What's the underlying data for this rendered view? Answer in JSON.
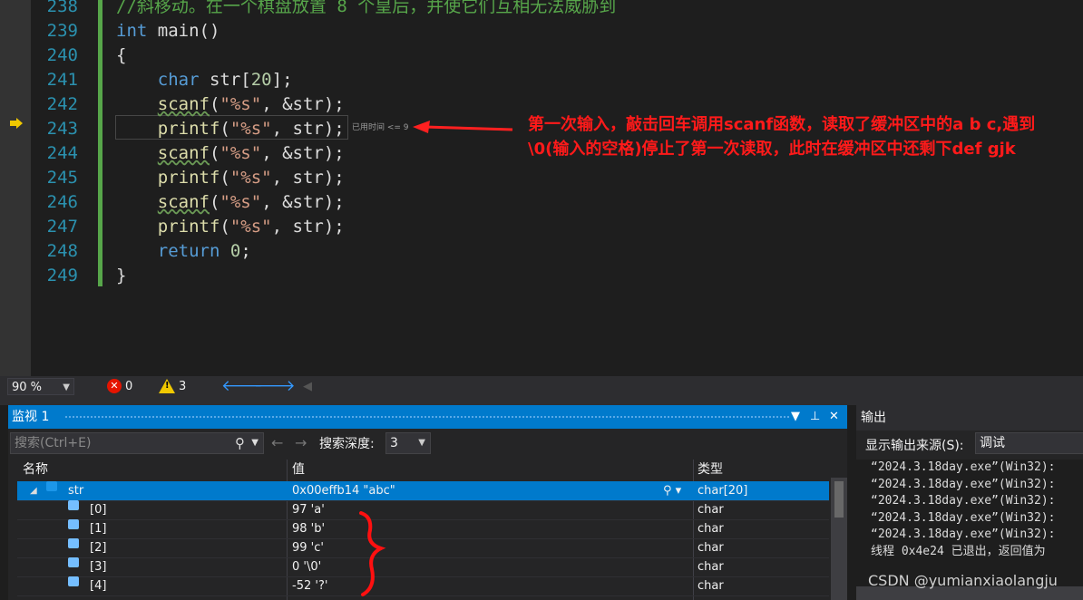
{
  "editor": {
    "lines": [
      {
        "num": "238",
        "parts": [
          {
            "t": "//斜移动。在一个棋盘放置 8 个皇后，并使它们互相无法威胁到",
            "c": "cm"
          }
        ]
      },
      {
        "num": "239",
        "parts": [
          {
            "t": "int",
            "c": "kw"
          },
          {
            "t": " main()",
            "c": "id"
          }
        ]
      },
      {
        "num": "240",
        "parts": [
          {
            "t": "{",
            "c": "id"
          }
        ]
      },
      {
        "num": "241",
        "parts": [
          {
            "t": "    ",
            "c": "id"
          },
          {
            "t": "char",
            "c": "kw"
          },
          {
            "t": " str[",
            "c": "id"
          },
          {
            "t": "20",
            "c": "num"
          },
          {
            "t": "];",
            "c": "id"
          }
        ]
      },
      {
        "num": "242",
        "parts": [
          {
            "t": "    ",
            "c": "id"
          },
          {
            "t": "scanf",
            "c": "fn wavy"
          },
          {
            "t": "(",
            "c": "id"
          },
          {
            "t": "\"%s\"",
            "c": "str"
          },
          {
            "t": ", &str);",
            "c": "id"
          }
        ]
      },
      {
        "num": "243",
        "parts": [
          {
            "t": "    ",
            "c": "id"
          },
          {
            "t": "printf",
            "c": "fn"
          },
          {
            "t": "(",
            "c": "id"
          },
          {
            "t": "\"%s\"",
            "c": "str"
          },
          {
            "t": ", str);",
            "c": "id"
          }
        ]
      },
      {
        "num": "244",
        "parts": [
          {
            "t": "    ",
            "c": "id"
          },
          {
            "t": "scanf",
            "c": "fn wavy"
          },
          {
            "t": "(",
            "c": "id"
          },
          {
            "t": "\"%s\"",
            "c": "str"
          },
          {
            "t": ", &str);",
            "c": "id"
          }
        ]
      },
      {
        "num": "245",
        "parts": [
          {
            "t": "    ",
            "c": "id"
          },
          {
            "t": "printf",
            "c": "fn"
          },
          {
            "t": "(",
            "c": "id"
          },
          {
            "t": "\"%s\"",
            "c": "str"
          },
          {
            "t": ", str);",
            "c": "id"
          }
        ]
      },
      {
        "num": "246",
        "parts": [
          {
            "t": "    ",
            "c": "id"
          },
          {
            "t": "scanf",
            "c": "fn wavy"
          },
          {
            "t": "(",
            "c": "id"
          },
          {
            "t": "\"%s\"",
            "c": "str"
          },
          {
            "t": ", &str);",
            "c": "id"
          }
        ]
      },
      {
        "num": "247",
        "parts": [
          {
            "t": "    ",
            "c": "id"
          },
          {
            "t": "printf",
            "c": "fn"
          },
          {
            "t": "(",
            "c": "id"
          },
          {
            "t": "\"%s\"",
            "c": "str"
          },
          {
            "t": ", str);",
            "c": "id"
          }
        ]
      },
      {
        "num": "248",
        "parts": [
          {
            "t": "    ",
            "c": "id"
          },
          {
            "t": "return",
            "c": "kw"
          },
          {
            "t": " ",
            "c": "id"
          },
          {
            "t": "0",
            "c": "num"
          },
          {
            "t": ";",
            "c": "id"
          }
        ]
      },
      {
        "num": "249",
        "parts": [
          {
            "t": "}",
            "c": "id"
          }
        ]
      }
    ],
    "elapsed_hint": "已用时间 <= 9",
    "annotation_line1": "第一次输入，敲击回车调用scanf函数，读取了缓冲区中的a b c,遇到",
    "annotation_line2": "\\0(输入的空格)停止了第一次读取，此时在缓冲区中还剩下def gjk"
  },
  "status": {
    "zoom": "90 %",
    "errors": "0",
    "warnings": "3"
  },
  "watch": {
    "title": "监视 1",
    "search_placeholder": "搜索(Ctrl+E)",
    "depth_label": "搜索深度:",
    "depth_value": "3",
    "columns": {
      "name": "名称",
      "value": "值",
      "type": "类型"
    },
    "rows": [
      {
        "name": "str",
        "value": "0x00effb14 \"abc\"",
        "type": "char[20]"
      },
      {
        "name": "[0]",
        "value": "97 'a'",
        "type": "char"
      },
      {
        "name": "[1]",
        "value": "98 'b'",
        "type": "char"
      },
      {
        "name": "[2]",
        "value": "99 'c'",
        "type": "char"
      },
      {
        "name": "[3]",
        "value": "0 '\\0'",
        "type": "char"
      },
      {
        "name": "[4]",
        "value": "-52 '?'",
        "type": "char"
      }
    ]
  },
  "output": {
    "title": "输出",
    "source_label": "显示输出来源(S):",
    "source_value": "调试",
    "lines": [
      "“2024.3.18day.exe”(Win32):",
      "“2024.3.18day.exe”(Win32):",
      "“2024.3.18day.exe”(Win32):",
      "“2024.3.18day.exe”(Win32):",
      "“2024.3.18day.exe”(Win32):",
      "线程 0x4e24 已退出，返回值为"
    ]
  },
  "watermark": "CSDN @yumianxiaolangju"
}
